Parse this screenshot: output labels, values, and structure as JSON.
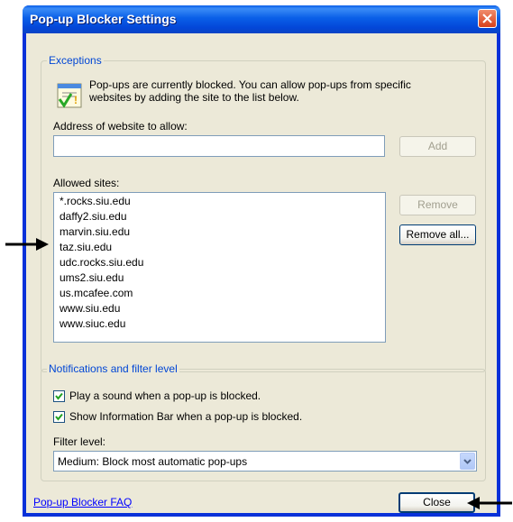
{
  "window": {
    "title": "Pop-up Blocker Settings"
  },
  "exceptions": {
    "legend": "Exceptions",
    "info_line1": "Pop-ups are currently blocked.  You can allow pop-ups from specific",
    "info_line2": "websites by adding the site to the list below.",
    "address_label": "Address of website to allow:",
    "address_value": "",
    "add_label": "Add",
    "allowed_label": "Allowed sites:",
    "allowed_sites": [
      "*.rocks.siu.edu",
      "daffy2.siu.edu",
      "marvin.siu.edu",
      "taz.siu.edu",
      "udc.rocks.siu.edu",
      "ums2.siu.edu",
      "us.mcafee.com",
      "www.siu.edu",
      "www.siuc.edu"
    ],
    "remove_label": "Remove",
    "remove_all_label": "Remove all..."
  },
  "notifications": {
    "legend": "Notifications and filter level",
    "play_sound_label": "Play a sound when a pop-up is blocked.",
    "play_sound_checked": true,
    "info_bar_label": "Show Information Bar when a pop-up is blocked.",
    "info_bar_checked": true,
    "filter_label": "Filter level:",
    "filter_value": "Medium: Block most automatic pop-ups"
  },
  "footer": {
    "faq_link": "Pop-up Blocker FAQ",
    "close_label": "Close"
  },
  "colors": {
    "title_bar": "#0a5fe8",
    "legend_text": "#0046d5",
    "dialog_bg": "#ece9d8",
    "link": "#0000ff"
  }
}
